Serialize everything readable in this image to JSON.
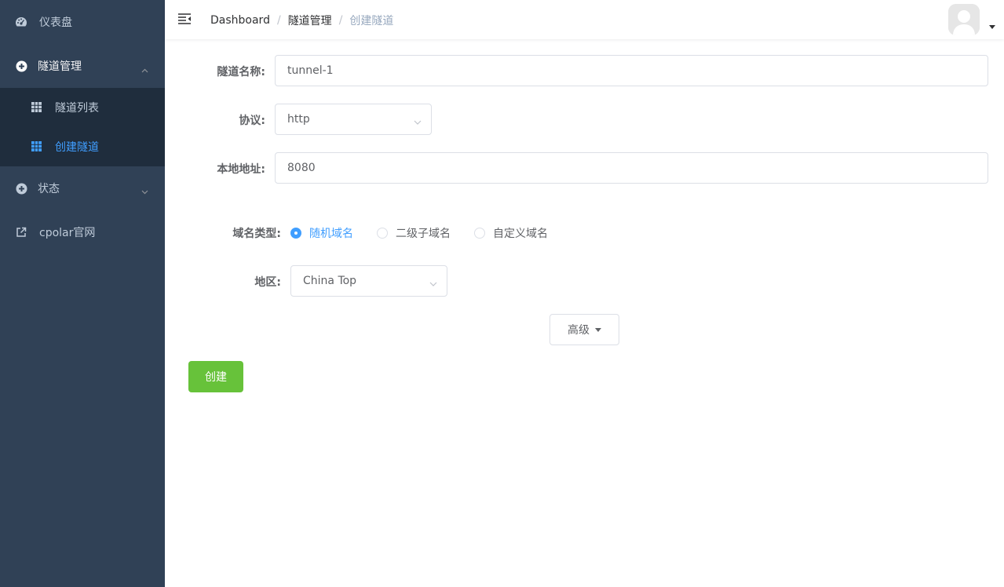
{
  "sidebar": {
    "dashboard_label": "仪表盘",
    "tunnel_mgmt_label": "隧道管理",
    "tunnel_list_label": "隧道列表",
    "create_tunnel_label": "创建隧道",
    "status_label": "状态",
    "cpolar_site_label": "cpolar官网",
    "icons": {
      "dashboard": "dashboard-icon",
      "tunnel_mgmt": "plus-circle-icon",
      "tunnel_list": "table-grid-icon",
      "create_tunnel": "table-grid-icon",
      "status": "plus-circle-icon",
      "cpolar_site": "external-link-icon"
    }
  },
  "header": {
    "breadcrumb": [
      "Dashboard",
      "隧道管理",
      "创建隧道"
    ],
    "separator": "/"
  },
  "form": {
    "name_label": "隧道名称:",
    "name_value": "tunnel-1",
    "protocol_label": "协议:",
    "protocol_value": "http",
    "local_addr_label": "本地地址:",
    "local_addr_value": "8080",
    "domain_type_label": "域名类型:",
    "domain_types": [
      "随机域名",
      "二级子域名",
      "自定义域名"
    ],
    "domain_type_selected": "随机域名",
    "region_label": "地区:",
    "region_value": "China Top",
    "advanced_label": "高级",
    "create_label": "创建"
  },
  "colors": {
    "sidebar_bg": "#304156",
    "submenu_bg": "#1f2d3d",
    "menu_text": "#bfcbd9",
    "active": "#409eff",
    "create_button": "#67c23a"
  }
}
